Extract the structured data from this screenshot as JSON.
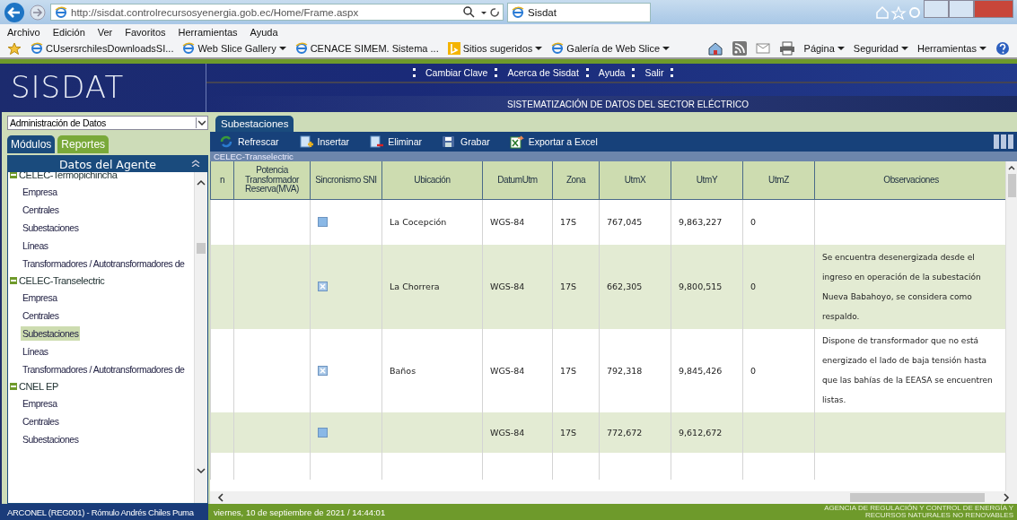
{
  "browser": {
    "url": "http://sisdat.controlrecursosyenergia.gob.ec/Home/Frame.aspx",
    "tab_title": "Sisdat",
    "menu": [
      "Archivo",
      "Edición",
      "Ver",
      "Favoritos",
      "Herramientas",
      "Ayuda"
    ],
    "favorites": [
      {
        "label": "CUsersrchilesDownloadsSI...",
        "kind": "ie",
        "dropdown": false
      },
      {
        "label": "Web Slice Gallery",
        "kind": "ie",
        "dropdown": true
      },
      {
        "label": "CENACE SIMEM. Sistema ...",
        "kind": "ie",
        "dropdown": false
      },
      {
        "label": "Sitios sugeridos",
        "kind": "bing",
        "dropdown": true
      },
      {
        "label": "Galería de Web Slice",
        "kind": "ie",
        "dropdown": true
      }
    ],
    "commands": [
      "Página",
      "Seguridad",
      "Herramientas"
    ]
  },
  "header": {
    "logo": "SISDAT",
    "links": [
      "Cambiar Clave",
      "Acerca de Sisdat",
      "Ayuda",
      "Salir"
    ],
    "subtitle": "SISTEMATIZACIÓN DE DATOS DEL SECTOR ELÉCTRICO"
  },
  "sidebar": {
    "dropdown": "Administración de Datos",
    "tabs": [
      {
        "label": "Módulos",
        "selected": true
      },
      {
        "label": "Reportes",
        "selected": false
      }
    ],
    "panel_title": "Datos del Agente",
    "tree": [
      {
        "label": "CELEC-Termopichincha",
        "expanded": true,
        "children": [
          {
            "label": "Empresa",
            "selected": false
          },
          {
            "label": "Centrales",
            "selected": false
          },
          {
            "label": "Subestaciones",
            "selected": false
          },
          {
            "label": "Líneas",
            "selected": false
          },
          {
            "label": "Transformadores / Autotransformadores de",
            "selected": false
          }
        ]
      },
      {
        "label": "CELEC-Transelectric",
        "expanded": true,
        "children": [
          {
            "label": "Empresa",
            "selected": false
          },
          {
            "label": "Centrales",
            "selected": false
          },
          {
            "label": "Subestaciones",
            "selected": true
          },
          {
            "label": "Líneas",
            "selected": false
          },
          {
            "label": "Transformadores / Autotransformadores de",
            "selected": false
          }
        ]
      },
      {
        "label": "CNEL EP",
        "expanded": true,
        "children": [
          {
            "label": "Empresa",
            "selected": false
          },
          {
            "label": "Centrales",
            "selected": false
          },
          {
            "label": "Subestaciones",
            "selected": false
          }
        ]
      }
    ]
  },
  "content": {
    "tab": "Subestaciones",
    "toolbar": [
      {
        "label": "Refrescar",
        "kind": "refresh"
      },
      {
        "label": "Insertar",
        "kind": "insert"
      },
      {
        "label": "Eliminar",
        "kind": "delete"
      },
      {
        "label": "Grabar",
        "kind": "save"
      },
      {
        "label": "Exportar a Excel",
        "kind": "excel"
      }
    ],
    "group": "CELEC-Transelectric",
    "columns": [
      "n",
      "Potencia Transformador Reserva(MVA)",
      "Sincronismo SNI",
      "Ubicación",
      "DatumUtm",
      "Zona",
      "UtmX",
      "UtmY",
      "UtmZ",
      "Observaciones"
    ],
    "rows": [
      {
        "sincronismo": false,
        "ubicacion": "La Cocepción",
        "datum": "WGS-84",
        "zona": "17S",
        "utmx": "767,045",
        "utmy": "9,863,227",
        "utmz": "0",
        "observaciones": ""
      },
      {
        "sincronismo": true,
        "ubicacion": "La Chorrera",
        "datum": "WGS-84",
        "zona": "17S",
        "utmx": "662,305",
        "utmy": "9,800,515",
        "utmz": "0",
        "observaciones": "Se encuentra desenergizada desde el ingreso en operación de la subestación Nueva Babahoyo, se considera como respaldo."
      },
      {
        "sincronismo": true,
        "ubicacion": "Baños",
        "datum": "WGS-84",
        "zona": "17S",
        "utmx": "792,318",
        "utmy": "9,845,426",
        "utmz": "0",
        "observaciones": "Dispone de transformador que no está energizado el lado de baja tensión hasta que las bahías de la EEASA se encuentren listas."
      },
      {
        "sincronismo": false,
        "ubicacion": "",
        "datum": "WGS-84",
        "zona": "17S",
        "utmx": "772,672",
        "utmy": "9,612,672",
        "utmz": "",
        "observaciones": ""
      }
    ]
  },
  "footer": {
    "user": "ARCONEL (REG001) - Rómulo Andrés Chiles Puma",
    "datetime": "viernes, 10 de septiembre de 2021 / 14:44:01",
    "agency": "AGENCIA DE REGULACIÓN Y CONTROL DE ENERGÍA Y RECURSOS NATURALES NO RENOVABLES"
  }
}
